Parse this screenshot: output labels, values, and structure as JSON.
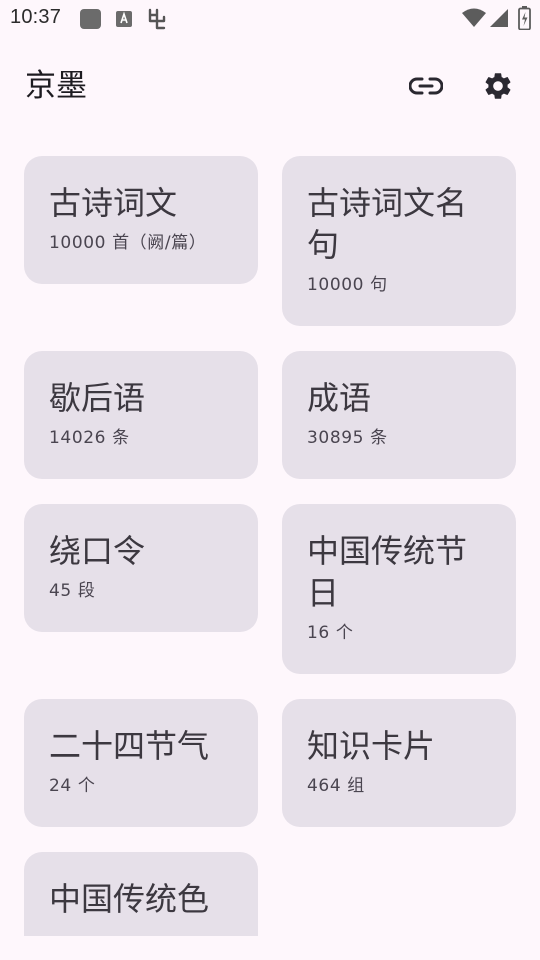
{
  "status_bar": {
    "time": "10:37"
  },
  "app_bar": {
    "title": "京墨",
    "link_icon": "link-icon",
    "settings_icon": "gear-icon"
  },
  "cards": [
    {
      "title": "古诗词文",
      "count": "10000 首（阙/篇）"
    },
    {
      "title": "古诗词文名句",
      "count": "10000 句"
    },
    {
      "title": "歇后语",
      "count": "14026 条"
    },
    {
      "title": "成语",
      "count": "30895 条"
    },
    {
      "title": "绕口令",
      "count": "45 段"
    },
    {
      "title": "中国传统节日",
      "count": "16 个"
    },
    {
      "title": "二十四节气",
      "count": "24 个"
    },
    {
      "title": "知识卡片",
      "count": "464 组"
    },
    {
      "title": "中国传统色",
      "count": ""
    }
  ],
  "colors": {
    "background": "#fef7fc",
    "card": "#e6e0e9",
    "text": "#1d1b20"
  }
}
